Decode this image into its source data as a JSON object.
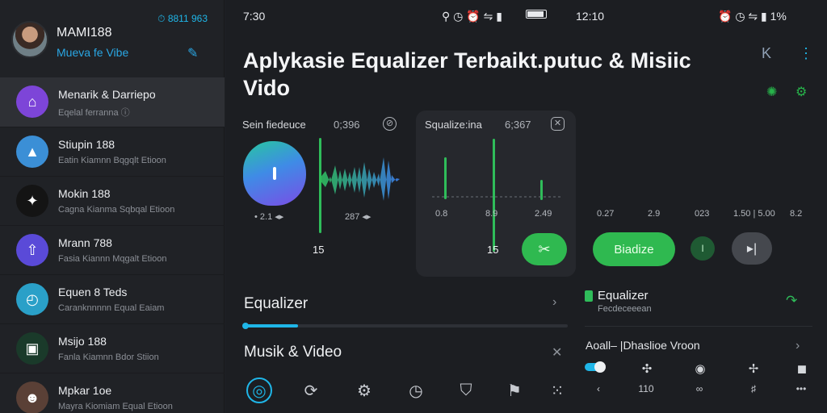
{
  "sidebar": {
    "status": "⏱ 8811 963",
    "profile": {
      "name": "MAMI188",
      "subtitle": "Mueva fe Vibe"
    },
    "items": [
      {
        "title": "Menarik & Darriepo",
        "desc": "Eqelal ferranna ⓘ",
        "icon_color": "#7d45d8",
        "icon": "house-icon",
        "glyph": "⌂",
        "active": true
      },
      {
        "title": "Stiupin 188",
        "desc": "Eatin Kiamnn Bqgqlt Etioon",
        "icon_color": "#3b8fd6",
        "icon": "landscape-icon",
        "glyph": "▲",
        "active": false
      },
      {
        "title": "Mokin 188",
        "desc": "Cagna Kianma Sqbqal Etioon",
        "icon_color": "#141414",
        "icon": "flame-icon",
        "glyph": "✦",
        "active": false
      },
      {
        "title": "Mrann 788",
        "desc": "Fasia Kiannn Mqgalt Etioon",
        "icon_color": "#5a4ad8",
        "icon": "share-icon",
        "glyph": "⇧",
        "active": false
      },
      {
        "title": "Equen 8 Teds",
        "desc": "Caranknnnnn Equal Eaiam",
        "icon_color": "#2aa0c8",
        "icon": "timer-icon",
        "glyph": "◴",
        "active": false
      },
      {
        "title": "Msijo 188",
        "desc": "Fanla Kiamnn Bdor Stiion",
        "icon_color": "#1a3a2a",
        "icon": "frame-icon",
        "glyph": "▣",
        "active": false
      },
      {
        "title": "Mpkar 1oe",
        "desc": "Mayra Kiomiam Equal Etioon",
        "icon_color": "#5a4036",
        "icon": "person-avatar",
        "glyph": "☻",
        "active": false
      }
    ]
  },
  "main": {
    "status_left": {
      "time": "7:30",
      "icons": "⚲ ◷ ⏰ ⇋ ▮"
    },
    "status_right": {
      "time": "12:10",
      "icons": "⏰ ◷ ⇋ ▮ 1%"
    },
    "title": "Aplykasie Equalizer Terbaikt.putuc & Misiic Vido",
    "header_icons": {
      "back": "K",
      "menu": "⋮",
      "green_a": "✺",
      "green_b": "⚙"
    },
    "card1": {
      "label": "Sein fiedeuce",
      "value": "0;396",
      "close": "⊘",
      "ticks": [
        "• 2.1 ◂▸",
        "287 ◂▸"
      ],
      "count": "15"
    },
    "card2": {
      "label": "Squalize:ina",
      "value": "6;367",
      "close": "✕",
      "ticks": [
        "0.8",
        "8.9",
        "2.49"
      ],
      "count": "15",
      "action_glyph": "✂"
    },
    "card3": {
      "ticks": [
        "0.27",
        "2.9",
        "023",
        "1.50 | 5.00",
        "8.2"
      ],
      "green_button": "Biadize",
      "dot_glyph": "I",
      "play_glyph": "▸|"
    },
    "rows": {
      "equalizer": "Equalizer",
      "musik_video": "Musik & Video",
      "chevron": "›",
      "close": "✕",
      "progress": 0.17
    },
    "right_panel": {
      "title": "Equalizer",
      "subtitle": "Fecdeceeean",
      "call_glyph": "↷",
      "row": "Aoall– |Dhaslioe Vroon",
      "row_chevron": "›"
    },
    "nav": [
      {
        "name": "nav-home-icon",
        "glyph": "◎",
        "active": true
      },
      {
        "name": "nav-refresh-icon",
        "glyph": "⟳",
        "active": false
      },
      {
        "name": "nav-settings-icon",
        "glyph": "⚙",
        "active": false
      },
      {
        "name": "nav-compass-icon",
        "glyph": "◷",
        "active": false
      },
      {
        "name": "nav-bookmark-icon",
        "glyph": "⛉",
        "active": false
      },
      {
        "name": "nav-tag-icon",
        "glyph": "⚑",
        "active": false
      },
      {
        "name": "nav-grid-icon",
        "glyph": "⁙",
        "active": false
      }
    ],
    "right_nav": {
      "icons": [
        "✣",
        "◉",
        "✢",
        "◼"
      ],
      "labels": [
        "‹",
        "110",
        "∞",
        "♯",
        "•••"
      ]
    }
  }
}
